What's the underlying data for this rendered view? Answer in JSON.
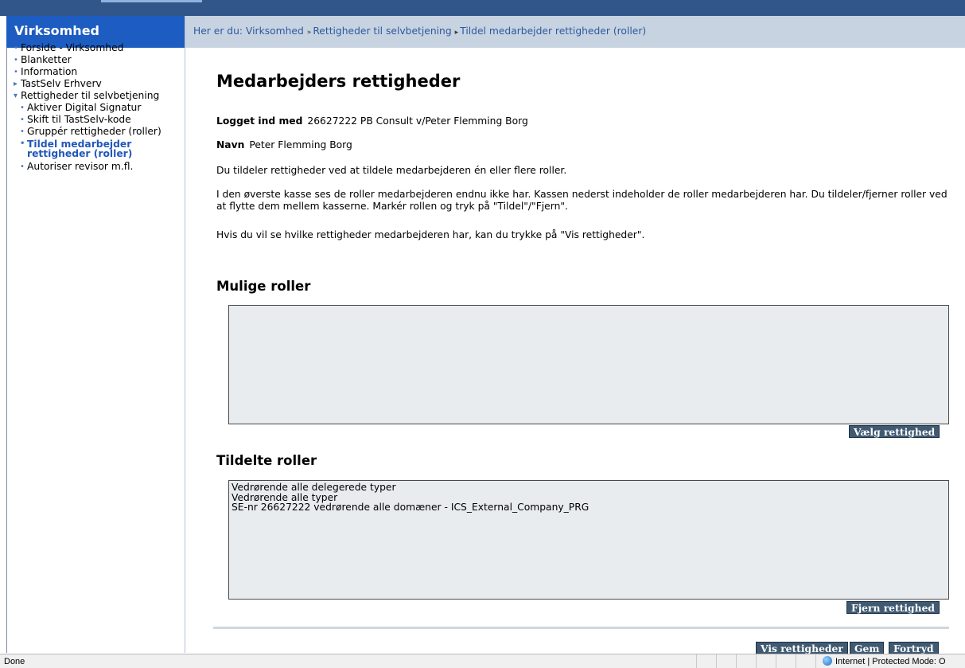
{
  "left_panel": {
    "header": "Virksomhed",
    "nav": [
      {
        "label": "Forside - Virksomhed",
        "marker": "•"
      },
      {
        "label": "Blanketter",
        "marker": "•"
      },
      {
        "label": "Information",
        "marker": "•"
      },
      {
        "label": "TastSelv Erhverv",
        "marker": "▸"
      },
      {
        "label": "Rettigheder til selvbetjening",
        "marker": "▾"
      }
    ],
    "subnav": [
      {
        "label": "Aktiver Digital Signatur"
      },
      {
        "label": "Skift til TastSelv-kode"
      },
      {
        "label": "Gruppér rettigheder (roller)"
      },
      {
        "label_line1": "Tildel medarbejder",
        "label_line2": "rettigheder (roller)"
      },
      {
        "label": "Autoriser revisor m.fl."
      }
    ]
  },
  "breadcrumb": {
    "prefix": "Her er du:",
    "items": [
      "Virksomhed",
      "Rettigheder til selvbetjening",
      "Tildel medarbejder rettigheder (roller)"
    ]
  },
  "page": {
    "title": "Medarbejders rettigheder",
    "logged_in_label": "Logget ind med",
    "logged_in_value": "26627222  PB Consult v/Peter Flemming Borg",
    "name_label": "Navn",
    "name_value": "Peter Flemming Borg",
    "paragraph1": "Du tildeler rettigheder ved at tildele medarbejderen én eller flere roller.",
    "paragraph2": "I den øverste kasse ses de roller medarbejderen endnu ikke har. Kassen nederst indeholder de roller medarbejderen har. Du tildeler/fjerner roller ved at flytte dem mellem kasserne. Markér rollen og tryk på \"Tildel\"/\"Fjern\".",
    "paragraph3": "Hvis du vil se hvilke rettigheder medarbejderen har, kan du trykke på \"Vis rettigheder\"."
  },
  "possible_roles": {
    "heading": "Mulige roller",
    "items": [],
    "button": "Vælg rettighed"
  },
  "assigned_roles": {
    "heading": "Tildelte roller",
    "items": [
      "Vedrørende alle delegerede typer",
      "Vedrørende alle typer",
      "SE-nr 26627222 vedrørende alle domæner - ICS_External_Company_PRG"
    ],
    "button": "Fjern rettighed"
  },
  "footer_buttons": {
    "show": "Vis rettigheder",
    "save": "Gem",
    "cancel": "Fortryd"
  },
  "statusbar": {
    "left": "Done",
    "zone": "Internet | Protected Mode: O"
  }
}
